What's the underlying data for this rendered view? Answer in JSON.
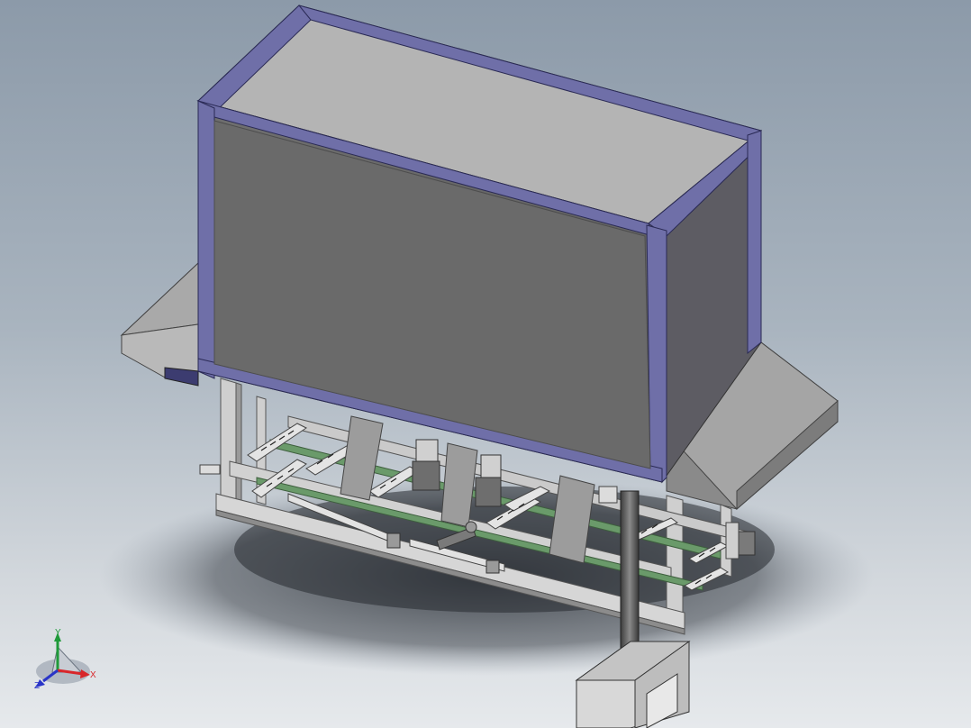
{
  "viewport": {
    "background_top": "#8c9aa9",
    "background_bottom": "#e6e9ec"
  },
  "colors": {
    "panel_face": "#6b6b6b",
    "panel_top": "#b4b4b4",
    "panel_side": "#5c5b62",
    "frame_blue": "#6f6fa8",
    "frame_blue_dark": "#4a4a86",
    "steel_light": "#d9d9d9",
    "steel_mid": "#a8a8a8",
    "belt_green": "#6a9a6a"
  },
  "triad": {
    "x_label": "X",
    "y_label": "Y",
    "z_label": "Z",
    "x_color": "#d8262a",
    "y_color": "#1f9a3a",
    "z_color": "#2a35c8"
  }
}
